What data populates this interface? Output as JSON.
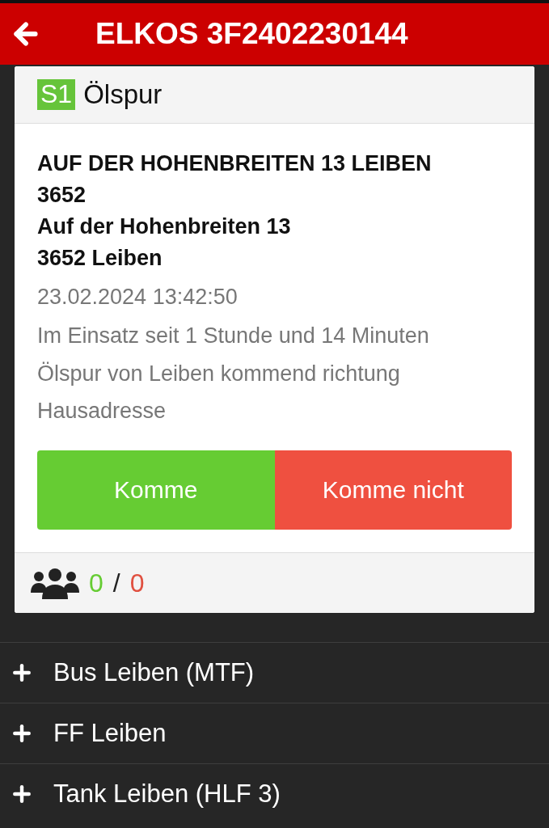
{
  "header": {
    "title": "ELKOS 3F2402230144"
  },
  "incident": {
    "badge": {
      "text": "S1",
      "color": "#66c43a"
    },
    "title": "Ölspur",
    "address_lines": [
      "AUF DER HOHENBREITEN 13 LEIBEN 3652",
      "Auf der Hohenbreiten 13",
      "3652 Leiben"
    ],
    "timestamp": "23.02.2024 13:42:50",
    "duration": "Im Einsatz seit 1 Stunde und 14 Minuten",
    "description": "Ölspur von Leiben kommend richtung Hausadresse",
    "buttons": [
      {
        "label": "Komme",
        "kind": "accept"
      },
      {
        "label": "Komme nicht",
        "kind": "decline"
      }
    ],
    "responses": {
      "coming": "0",
      "separator": "/",
      "not_coming": "0"
    }
  },
  "groups": [
    {
      "label": "Bus Leiben (MTF)",
      "expanded": false
    },
    {
      "label": "FF Leiben",
      "expanded": false
    },
    {
      "label": "Tank Leiben (HLF 3)",
      "expanded": false
    }
  ]
}
